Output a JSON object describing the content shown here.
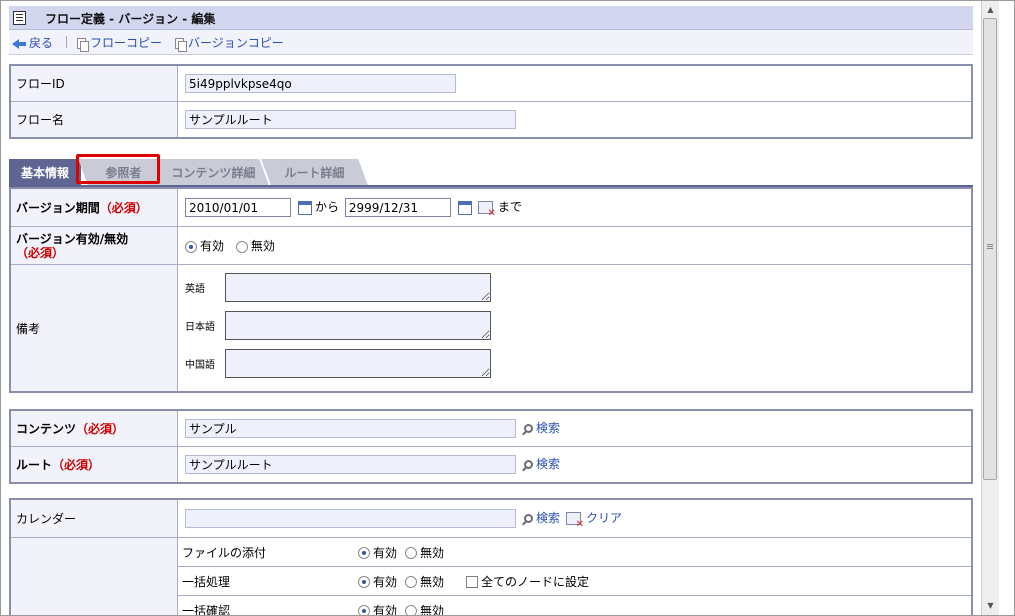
{
  "title": "フロー定義 - バージョン - 編集",
  "toolbar": {
    "back": "戻る",
    "flow_copy": "フローコピー",
    "version_copy": "バージョンコピー"
  },
  "flow": {
    "id_label": "フローID",
    "id_value": "5i49pplvkpse4qo",
    "name_label": "フロー名",
    "name_value": "サンプルルート"
  },
  "tabs": [
    "基本情報",
    "参照者",
    "コンテンツ詳細",
    "ルート詳細"
  ],
  "version": {
    "period_label": "バージョン期間",
    "required": "（必須）",
    "start_date": "2010/01/01",
    "from": "から",
    "end_date": "2999/12/31",
    "until": "まで",
    "enabled_label": "バージョン有効/無効",
    "enabled": "有効",
    "disabled": "無効",
    "note_label": "備考",
    "lang_en": "英語",
    "lang_ja": "日本語",
    "lang_zh": "中国語"
  },
  "content": {
    "content_label": "コンテンツ",
    "content_value": "サンプル",
    "route_label": "ルート",
    "route_value": "サンプルルート",
    "search": "検索"
  },
  "calendar": {
    "label": "カレンダー",
    "search": "検索",
    "clear": "クリア",
    "rows": [
      {
        "label": "ファイルの添付",
        "on": "有効",
        "off": "無効"
      },
      {
        "label": "一括処理",
        "on": "有効",
        "off": "無効",
        "extra": "全てのノードに設定"
      },
      {
        "label": "一括確認",
        "on": "有効",
        "off": "無効"
      }
    ]
  },
  "colors": {
    "accent": "#5f6592",
    "required": "#cc0000",
    "link": "#2a50b0",
    "highlight": "#e00000"
  }
}
